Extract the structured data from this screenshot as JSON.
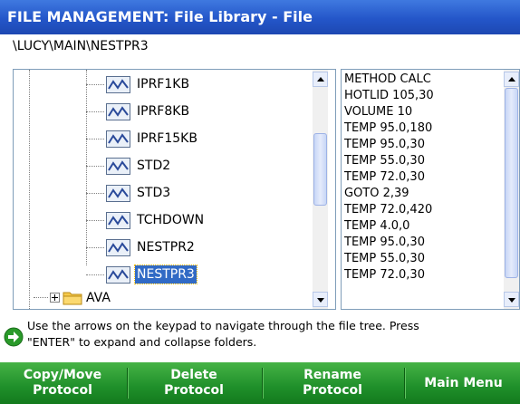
{
  "title": "FILE MANAGEMENT: File Library - File",
  "path": "\\LUCY\\MAIN\\NESTPR3",
  "tree": {
    "items": [
      "IPRF1KB",
      "IPRF8KB",
      "IPRF15KB",
      "STD2",
      "STD3",
      "TCHDOWN",
      "NESTPR2",
      "NESTPR3"
    ],
    "selected": "NESTPR3",
    "folder": "AVA"
  },
  "protocol_lines": [
    "METHOD CALC",
    "HOTLID 105,30",
    "VOLUME 10",
    "TEMP 95.0,180",
    "TEMP 95.0,30",
    "TEMP 55.0,30",
    "TEMP 72.0,30",
    "GOTO 2,39",
    "TEMP 72.0,420",
    "TEMP 4.0,0",
    "TEMP 95.0,30",
    "TEMP 55.0,30",
    "TEMP 72.0,30"
  ],
  "info": {
    "line1": "Use the arrows on the keypad to navigate through the file tree.  Press",
    "line2": "\"ENTER\" to expand and collapse folders.",
    "icon": "green-arrow-icon"
  },
  "softkeys": {
    "copy_move_1": "Copy/Move",
    "copy_move_2": "Protocol",
    "delete_1": "Delete",
    "delete_2": "Protocol",
    "rename_1": "Rename",
    "rename_2": "Protocol",
    "main_menu": "Main Menu"
  },
  "colors": {
    "titlebar": "#2456c9",
    "selection": "#316ac5",
    "softkey_bar": "#1f8f2a"
  }
}
